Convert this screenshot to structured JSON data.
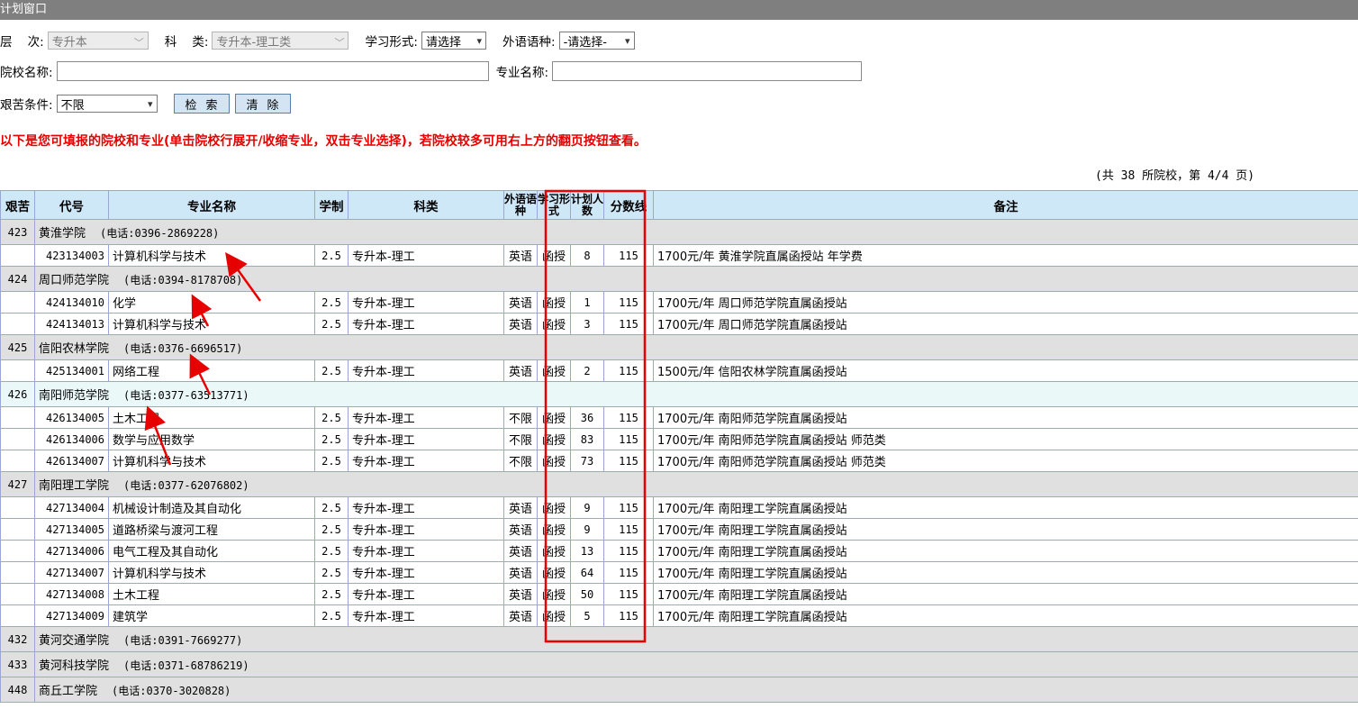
{
  "window_title": "计划窗口",
  "filters": {
    "level_label": "层    次:",
    "level_value": "专升本",
    "subject_label": "科    类:",
    "subject_value": "专升本-理工类",
    "study_form_label": "学习形式:",
    "study_form_value": "请选择",
    "foreign_lang_label": "外语语种:",
    "foreign_lang_value": "-请选择-",
    "school_name_label": "院校名称:",
    "school_name_value": "",
    "major_name_label": "专业名称:",
    "major_name_value": "",
    "hardship_label": "艰苦条件:",
    "hardship_value": "不限",
    "search_button": "检索",
    "clear_button": "清除"
  },
  "notice": "以下是您可填报的院校和专业(单击院校行展开/收缩专业，双击专业选择)，若院校较多可用右上方的翻页按钮查看。",
  "pager": "(共 38 所院校，第 4/4 页)",
  "table": {
    "headers": {
      "hardship": "艰苦",
      "code": "代号",
      "major": "专业名称",
      "years": "学制",
      "subject": "科类",
      "lang": "外语语种",
      "form": "学习形式",
      "plan": "计划人数",
      "score": "分数线",
      "remark": "备注"
    },
    "rows": [
      {
        "type": "school",
        "id": "423",
        "name": "黄淮学院",
        "phone": "(电话:0396-2869228)"
      },
      {
        "type": "major",
        "code": "423134003",
        "major": "计算机科学与技术",
        "years": "2.5",
        "subject": "专升本-理工",
        "lang": "英语",
        "form": "函授",
        "plan": "8",
        "score": "115",
        "remark": "1700元/年 黄淮学院直属函授站 年学费"
      },
      {
        "type": "school",
        "id": "424",
        "name": "周口师范学院",
        "phone": "(电话:0394-8178708)"
      },
      {
        "type": "major",
        "code": "424134010",
        "major": "化学",
        "years": "2.5",
        "subject": "专升本-理工",
        "lang": "英语",
        "form": "函授",
        "plan": "1",
        "score": "115",
        "remark": "1700元/年 周口师范学院直属函授站"
      },
      {
        "type": "major",
        "code": "424134013",
        "major": "计算机科学与技术",
        "years": "2.5",
        "subject": "专升本-理工",
        "lang": "英语",
        "form": "函授",
        "plan": "3",
        "score": "115",
        "remark": "1700元/年 周口师范学院直属函授站"
      },
      {
        "type": "school",
        "id": "425",
        "name": "信阳农林学院",
        "phone": "(电话:0376-6696517)"
      },
      {
        "type": "major",
        "code": "425134001",
        "major": "网络工程",
        "years": "2.5",
        "subject": "专升本-理工",
        "lang": "英语",
        "form": "函授",
        "plan": "2",
        "score": "115",
        "remark": "1500元/年 信阳农林学院直属函授站"
      },
      {
        "type": "school",
        "id": "426",
        "name": "南阳师范学院",
        "phone": "(电话:0377-63513771)",
        "highlight": true
      },
      {
        "type": "major",
        "code": "426134005",
        "major": "土木工程",
        "years": "2.5",
        "subject": "专升本-理工",
        "lang": "不限",
        "form": "函授",
        "plan": "36",
        "score": "115",
        "remark": "1700元/年 南阳师范学院直属函授站"
      },
      {
        "type": "major",
        "code": "426134006",
        "major": "数学与应用数学",
        "years": "2.5",
        "subject": "专升本-理工",
        "lang": "不限",
        "form": "函授",
        "plan": "83",
        "score": "115",
        "remark": "1700元/年 南阳师范学院直属函授站 师范类"
      },
      {
        "type": "major",
        "code": "426134007",
        "major": "计算机科学与技术",
        "years": "2.5",
        "subject": "专升本-理工",
        "lang": "不限",
        "form": "函授",
        "plan": "73",
        "score": "115",
        "remark": "1700元/年 南阳师范学院直属函授站 师范类"
      },
      {
        "type": "school",
        "id": "427",
        "name": "南阳理工学院",
        "phone": "(电话:0377-62076802)"
      },
      {
        "type": "major",
        "code": "427134004",
        "major": "机械设计制造及其自动化",
        "years": "2.5",
        "subject": "专升本-理工",
        "lang": "英语",
        "form": "函授",
        "plan": "9",
        "score": "115",
        "remark": "1700元/年 南阳理工学院直属函授站"
      },
      {
        "type": "major",
        "code": "427134005",
        "major": "道路桥梁与渡河工程",
        "years": "2.5",
        "subject": "专升本-理工",
        "lang": "英语",
        "form": "函授",
        "plan": "9",
        "score": "115",
        "remark": "1700元/年 南阳理工学院直属函授站"
      },
      {
        "type": "major",
        "code": "427134006",
        "major": "电气工程及其自动化",
        "years": "2.5",
        "subject": "专升本-理工",
        "lang": "英语",
        "form": "函授",
        "plan": "13",
        "score": "115",
        "remark": "1700元/年 南阳理工学院直属函授站"
      },
      {
        "type": "major",
        "code": "427134007",
        "major": "计算机科学与技术",
        "years": "2.5",
        "subject": "专升本-理工",
        "lang": "英语",
        "form": "函授",
        "plan": "64",
        "score": "115",
        "remark": "1700元/年 南阳理工学院直属函授站"
      },
      {
        "type": "major",
        "code": "427134008",
        "major": "土木工程",
        "years": "2.5",
        "subject": "专升本-理工",
        "lang": "英语",
        "form": "函授",
        "plan": "50",
        "score": "115",
        "remark": "1700元/年 南阳理工学院直属函授站"
      },
      {
        "type": "major",
        "code": "427134009",
        "major": "建筑学",
        "years": "2.5",
        "subject": "专升本-理工",
        "lang": "英语",
        "form": "函授",
        "plan": "5",
        "score": "115",
        "remark": "1700元/年 南阳理工学院直属函授站"
      },
      {
        "type": "school",
        "id": "432",
        "name": "黄河交通学院",
        "phone": "(电话:0391-7669277)"
      },
      {
        "type": "school",
        "id": "433",
        "name": "黄河科技学院",
        "phone": "(电话:0371-68786219)"
      },
      {
        "type": "school",
        "id": "448",
        "name": "商丘工学院",
        "phone": "(电话:0370-3020828)"
      }
    ]
  },
  "colors": {
    "annotation": "#e60000",
    "header_bg": "#cfe8f7",
    "school_row_bg": "#e0e0e0",
    "notice": "#e60000"
  }
}
